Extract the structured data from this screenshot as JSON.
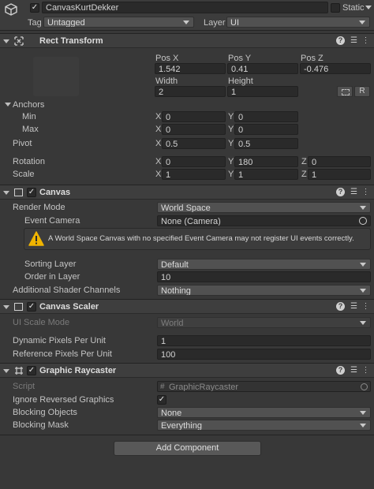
{
  "gameobject": {
    "name": "CanvasKurtDekker",
    "static_label": "Static",
    "tag_label": "Tag",
    "tag_value": "Untagged",
    "layer_label": "Layer",
    "layer_value": "UI"
  },
  "rect_transform": {
    "title": "Rect Transform",
    "pos_x_label": "Pos X",
    "pos_y_label": "Pos Y",
    "pos_z_label": "Pos Z",
    "pos_x": "1.542",
    "pos_y": "0.41",
    "pos_z": "-0.476",
    "width_label": "Width",
    "height_label": "Height",
    "width": "2",
    "height": "1",
    "r_button": "R",
    "anchors_label": "Anchors",
    "min_label": "Min",
    "max_label": "Max",
    "anchor_min_x": "0",
    "anchor_min_y": "0",
    "anchor_max_x": "0",
    "anchor_max_y": "0",
    "pivot_label": "Pivot",
    "pivot_x": "0.5",
    "pivot_y": "0.5",
    "rotation_label": "Rotation",
    "rot_x": "0",
    "rot_y": "180",
    "rot_z": "0",
    "scale_label": "Scale",
    "scale_x": "1",
    "scale_y": "1",
    "scale_z": "1",
    "x": "X",
    "y": "Y",
    "z": "Z"
  },
  "canvas": {
    "title": "Canvas",
    "render_mode_label": "Render Mode",
    "render_mode": "World Space",
    "event_camera_label": "Event Camera",
    "event_camera": "None (Camera)",
    "warning": "A World Space Canvas with no specified Event Camera may not register UI events correctly.",
    "sorting_layer_label": "Sorting Layer",
    "sorting_layer": "Default",
    "order_label": "Order in Layer",
    "order": "10",
    "shader_channels_label": "Additional Shader Channels",
    "shader_channels": "Nothing"
  },
  "canvas_scaler": {
    "title": "Canvas Scaler",
    "ui_scale_mode_label": "UI Scale Mode",
    "ui_scale_mode": "World",
    "dynamic_ppu_label": "Dynamic Pixels Per Unit",
    "dynamic_ppu": "1",
    "reference_ppu_label": "Reference Pixels Per Unit",
    "reference_ppu": "100"
  },
  "graphic_raycaster": {
    "title": "Graphic Raycaster",
    "script_label": "Script",
    "script": "GraphicRaycaster",
    "ignore_reversed_label": "Ignore Reversed Graphics",
    "ignore_reversed_check": "✓",
    "blocking_objects_label": "Blocking Objects",
    "blocking_objects": "None",
    "blocking_mask_label": "Blocking Mask",
    "blocking_mask": "Everything"
  },
  "add_component_label": "Add Component",
  "colors": {
    "background": "#383838",
    "field": "#2a2a2a",
    "header": "#3e3e3e",
    "warning": "#f0b400"
  }
}
